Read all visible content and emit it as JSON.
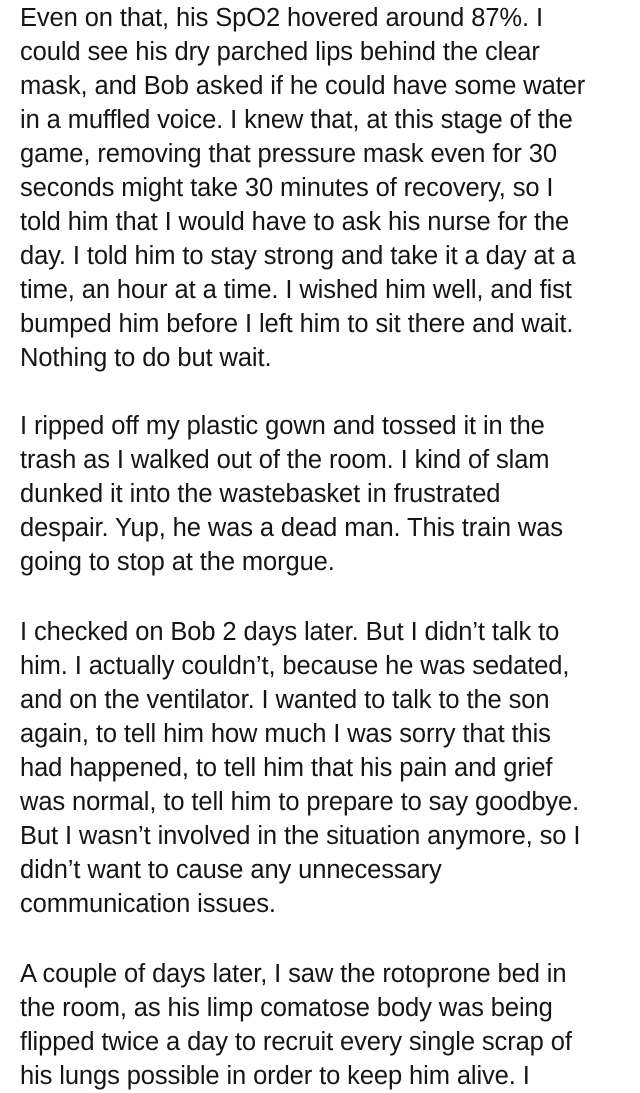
{
  "article": {
    "lines": [
      "Even on that, his SpO2 hovered around 87%. I",
      "could see his dry parched lips behind the clear",
      "mask, and Bob asked if he could have some water",
      "in a muffled voice. I knew that, at this stage of the",
      "game, removing that pressure mask even for 30",
      "seconds might take 30 minutes of recovery, so I",
      "told him that I would have to ask his nurse for the",
      "day. I told him to stay strong and take it a day at a",
      "time, an hour at a time. I wished him well, and fist",
      "bumped him before I left him to sit there and wait.",
      "Nothing to do but wait.",
      "I ripped off my plastic gown and tossed it in the",
      "trash as I walked out of the room. I kind of slam",
      "dunked it into the wastebasket in frustrated",
      "despair. Yup, he was a dead man. This train was",
      "going to stop at the morgue.",
      "I checked on Bob 2 days later. But I didn’t talk to",
      "him. I actually couldn’t, because he was sedated,",
      "and on the ventilator. I wanted to talk to the son",
      "again, to tell him how much I was sorry that this",
      "had happened, to tell him that his pain and grief",
      "was normal, to tell him to prepare to say goodbye.",
      "But I wasn’t involved in the situation anymore, so I",
      "didn’t want to cause any unnecessary",
      "communication issues.",
      "A couple of days later, I saw the rotoprone bed in",
      "the room, as his limp comatose body was being",
      "flipped twice a day to recruit every single scrap of",
      "his lungs possible in order to keep him alive. I"
    ]
  }
}
